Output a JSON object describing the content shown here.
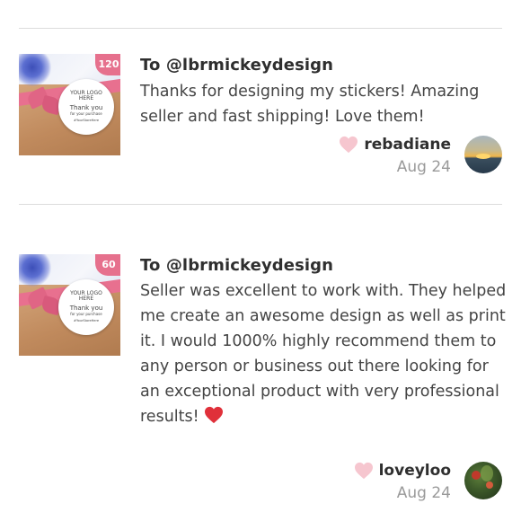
{
  "reviews": [
    {
      "recipient": "To @lbrmickeydesign",
      "text": "Thanks for designing my stickers! Amazing seller and fast shipping! Love them!",
      "emoji": "",
      "username": "rebadiane",
      "date": "Aug 24",
      "thumbnail": {
        "count_badge": "120",
        "sticker_line1": "YOUR LOGO",
        "sticker_line2": "HERE",
        "sticker_line3": "Thank you",
        "sticker_line4": "for your purchase",
        "sticker_line5": "#YourStoreHere"
      },
      "avatar": "sunset-avatar"
    },
    {
      "recipient": "To @lbrmickeydesign",
      "text": "Seller was excellent to work with. They helped me create an awesome design as well as print it. I would 1000% highly recommend them to any person or business out there looking for an exceptional product with very professional results!",
      "emoji": "red-heart-emoji",
      "username": "loveyloo",
      "date": "Aug 24",
      "thumbnail": {
        "count_badge": "60",
        "sticker_line1": "YOUR LOGO",
        "sticker_line2": "HERE",
        "sticker_line3": "Thank you",
        "sticker_line4": "for your purchase",
        "sticker_line5": "#YourStoreHere"
      },
      "avatar": "plant-avatar"
    }
  ],
  "colors": {
    "like_heart": "#f6c6cf",
    "emoji_heart": "#e0303a",
    "divider": "#dcdcdc",
    "date_gray": "#9a9a9a"
  }
}
